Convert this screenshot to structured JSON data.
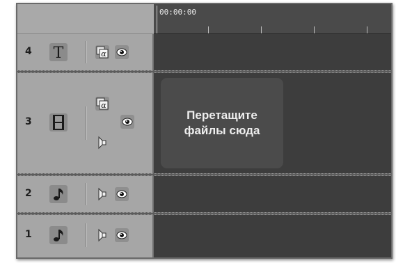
{
  "ruler": {
    "start_time": "00:00:00"
  },
  "drop_hint": {
    "line1": "Перетащите",
    "line2": "файлы сюда"
  },
  "tracks": [
    {
      "number": "4",
      "type": "text"
    },
    {
      "number": "3",
      "type": "video"
    },
    {
      "number": "2",
      "type": "audio"
    },
    {
      "number": "1",
      "type": "audio"
    }
  ]
}
